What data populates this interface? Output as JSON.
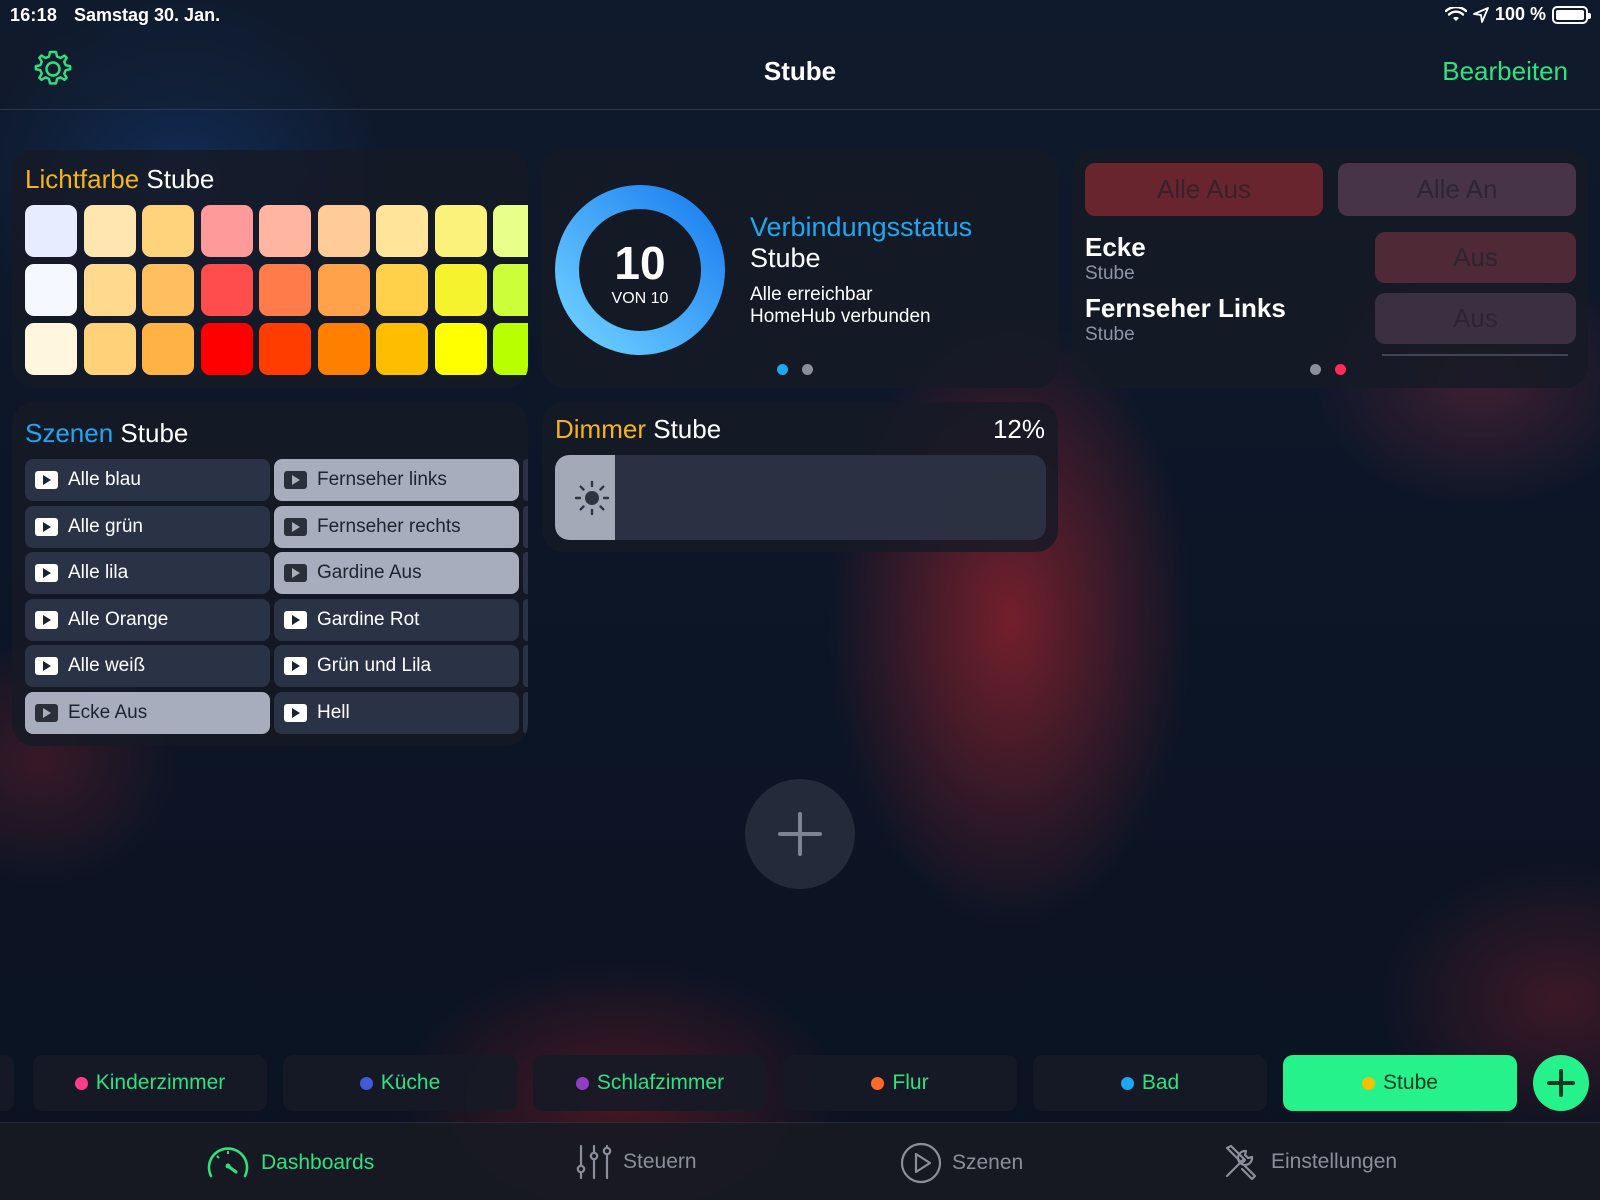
{
  "status_bar": {
    "time": "16:18",
    "date": "Samstag 30. Jan.",
    "battery": "100 %"
  },
  "nav": {
    "title": "Stube",
    "edit_label": "Bearbeiten",
    "settings_icon": "gear-icon"
  },
  "color_card": {
    "title_accent": "Lichtfarbe",
    "title_room": "Stube",
    "swatches": [
      [
        "#e8ecff",
        "#ffe6b0",
        "#ffd27c",
        "#ff9a9a",
        "#ffb5a0",
        "#ffcc99",
        "#ffe49a",
        "#fbf27c",
        "#e8ff8a"
      ],
      [
        "#f6f8ff",
        "#ffd98e",
        "#ffbf5e",
        "#ff4d4d",
        "#ff7b4a",
        "#ffa24a",
        "#ffd04a",
        "#f5f22e",
        "#ccff3a"
      ],
      [
        "#fff6de",
        "#ffd27a",
        "#ffb344",
        "#ff0000",
        "#ff3d00",
        "#ff7f00",
        "#ffbd00",
        "#ffff00",
        "#b8ff00"
      ]
    ]
  },
  "connection_card": {
    "count": "10",
    "total": "VON 10",
    "progress": 1.0,
    "title": "Verbindungsstatus",
    "room": "Stube",
    "line1": "Alle erreichbar",
    "line2": "HomeHub verbunden",
    "page_active": 0,
    "page_count": 2
  },
  "switch_card": {
    "all_off": "Alle Aus",
    "all_on": "Alle An",
    "devices": [
      {
        "name": "Ecke",
        "room": "Stube",
        "state": "Aus"
      },
      {
        "name": "Fernseher Links",
        "room": "Stube",
        "state": "Aus"
      }
    ],
    "page_active": 1,
    "page_count": 2
  },
  "scenes_card": {
    "title_accent": "Szenen",
    "title_room": "Stube",
    "col1": [
      {
        "label": "Alle blau",
        "active": false
      },
      {
        "label": "Alle grün",
        "active": false
      },
      {
        "label": "Alle lila",
        "active": false
      },
      {
        "label": "Alle Orange",
        "active": false
      },
      {
        "label": "Alle weiß",
        "active": false
      },
      {
        "label": "Ecke Aus",
        "active": true
      }
    ],
    "col2": [
      {
        "label": "Fernseher links",
        "active": true
      },
      {
        "label": "Fernseher rechts",
        "active": true
      },
      {
        "label": "Gardine Aus",
        "active": true
      },
      {
        "label": "Gardine Rot",
        "active": false
      },
      {
        "label": "Grün und Lila",
        "active": false
      },
      {
        "label": "Hell",
        "active": false
      }
    ]
  },
  "dimmer_card": {
    "title_accent": "Dimmer",
    "title_room": "Stube",
    "value": "12%",
    "level": 0.12,
    "icon": "sun-icon"
  },
  "add_widget_icon": "plus-icon",
  "rooms": [
    {
      "label": "Kinderzimmer",
      "color": "#ff3d8b",
      "active": false
    },
    {
      "label": "Küche",
      "color": "#3f5bd9",
      "active": false
    },
    {
      "label": "Schlafzimmer",
      "color": "#8e3fc4",
      "active": false
    },
    {
      "label": "Flur",
      "color": "#ff6a2a",
      "active": false
    },
    {
      "label": "Bad",
      "color": "#1fa6f0",
      "active": false
    },
    {
      "label": "Stube",
      "color": "#f5c000",
      "active": true
    }
  ],
  "tabs": [
    {
      "label": "Dashboards",
      "icon": "speedometer-icon",
      "active": true
    },
    {
      "label": "Steuern",
      "icon": "sliders-icon",
      "active": false
    },
    {
      "label": "Szenen",
      "icon": "play-circle-icon",
      "active": false
    },
    {
      "label": "Einstellungen",
      "icon": "tools-icon",
      "active": false
    }
  ],
  "colors": {
    "accent_green": "#2fe17f",
    "accent_blue": "#23a6f0",
    "accent_yellow": "#f5b41c"
  }
}
